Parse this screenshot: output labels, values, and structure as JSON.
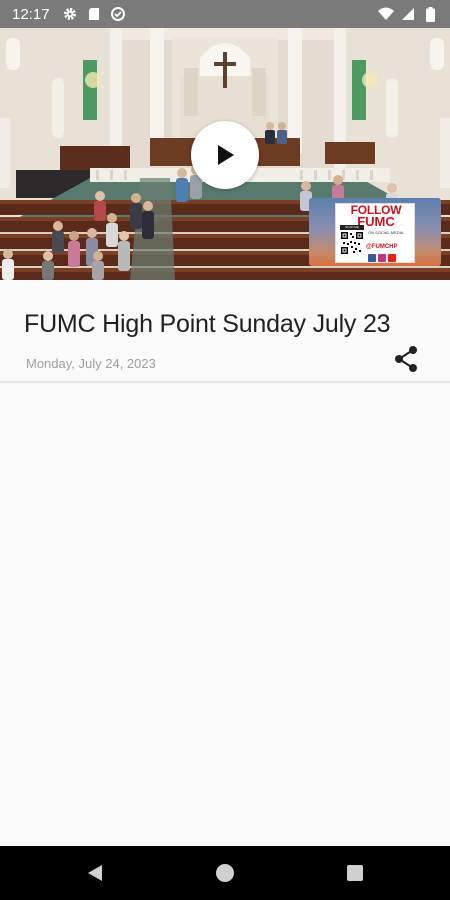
{
  "status_bar": {
    "time": "12:17",
    "left_icons": [
      "gear-icon",
      "sd-card-icon",
      "data-saver-icon"
    ],
    "right_icons": [
      "wifi-icon",
      "signal-icon",
      "battery-icon"
    ]
  },
  "video": {
    "play_icon": "play-icon",
    "sign": {
      "line1": "FOLLOW",
      "line2": "FUMC",
      "subtitle": "ON SOCIAL MEDIA",
      "scan_label": "SCAN ME",
      "handle": "@FUMCHP",
      "social_icons": [
        "facebook-icon",
        "instagram-icon",
        "youtube-icon"
      ]
    }
  },
  "post": {
    "title": "FUMC High Point Sunday July 23",
    "date": "Monday, July 24, 2023",
    "share_icon": "share-icon"
  },
  "nav_bar": {
    "buttons": [
      "back-icon",
      "home-icon",
      "recents-icon"
    ]
  },
  "colors": {
    "status_bar": "#7a7a7a",
    "background": "#fafafa",
    "title_text": "#212121",
    "date_text": "#9e9e9e",
    "sign_red": "#c4151c"
  }
}
